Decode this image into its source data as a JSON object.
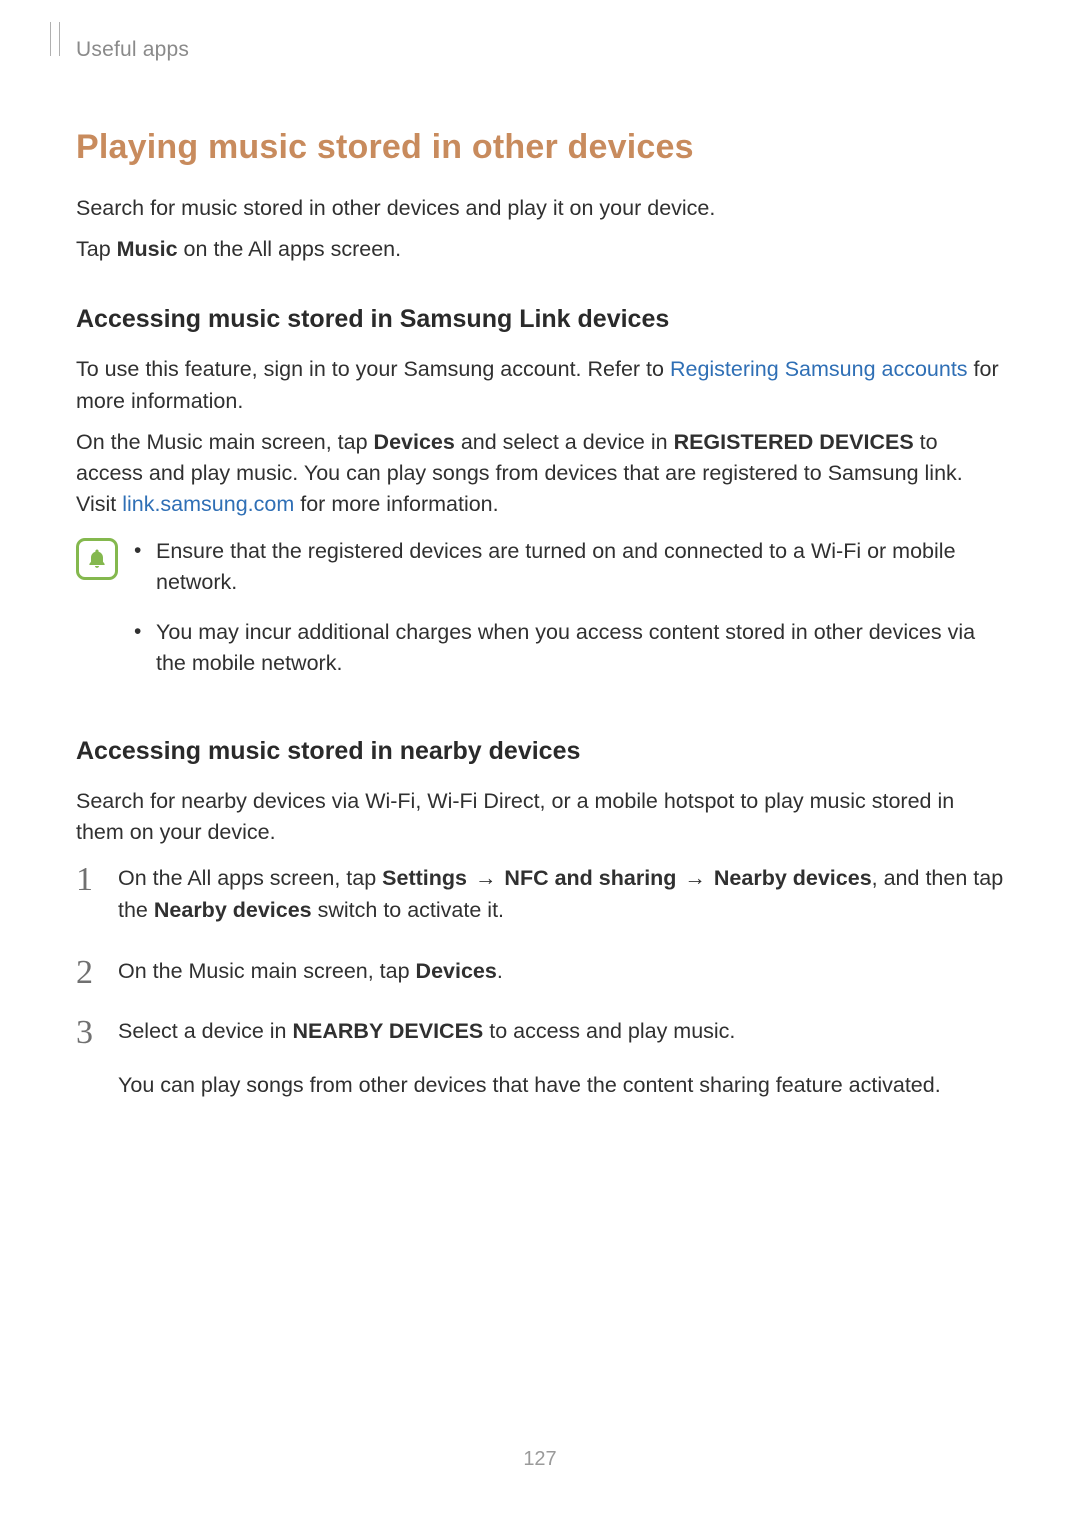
{
  "header": {
    "chapter": "Useful apps"
  },
  "title": "Playing music stored in other devices",
  "intro": {
    "p1": "Search for music stored in other devices and play it on your device.",
    "p2_prefix": "Tap ",
    "p2_bold": "Music",
    "p2_suffix": " on the All apps screen."
  },
  "section1": {
    "heading": "Accessing music stored in Samsung Link devices",
    "p1_a": "To use this feature, sign in to your Samsung account. Refer to ",
    "p1_link": "Registering Samsung accounts",
    "p1_b": " for more information.",
    "p2_a": "On the Music main screen, tap ",
    "p2_bold1": "Devices",
    "p2_b": " and select a device in ",
    "p2_bold2": "REGISTERED DEVICES",
    "p2_c": " to access and play music. You can play songs from devices that are registered to Samsung link. Visit ",
    "p2_link": "link.samsung.com",
    "p2_d": " for more information.",
    "notes": [
      "Ensure that the registered devices are turned on and connected to a Wi-Fi or mobile network.",
      "You may incur additional charges when you access content stored in other devices via the mobile network."
    ]
  },
  "section2": {
    "heading": "Accessing music stored in nearby devices",
    "intro": "Search for nearby devices via Wi-Fi, Wi-Fi Direct, or a mobile hotspot to play music stored in them on your device.",
    "steps": {
      "s1": {
        "a": "On the All apps screen, tap ",
        "b1": "Settings",
        "arrow1": " → ",
        "b2": "NFC and sharing",
        "arrow2": " → ",
        "b3": "Nearby devices",
        "c": ", and then tap the ",
        "b4": "Nearby devices",
        "d": " switch to activate it."
      },
      "s2": {
        "a": "On the Music main screen, tap ",
        "b1": "Devices",
        "c": "."
      },
      "s3": {
        "a": "Select a device in ",
        "b1": "NEARBY DEVICES",
        "c": " to access and play music.",
        "sub": "You can play songs from other devices that have the content sharing feature activated."
      }
    }
  },
  "pageNumber": "127"
}
